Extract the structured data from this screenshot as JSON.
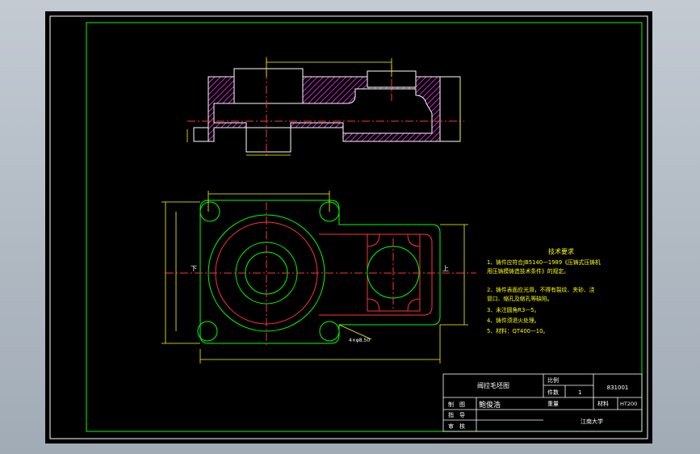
{
  "tech_requirements": {
    "title": "技术要求",
    "lines": [
      "1、铸件应符合JB5140—1989《压铸式压铸机",
      "用压铸模铸造技术条件》的规定。",
      "2、铸件表面应光滑，不得有裂纹、夹砂、浇",
      "冒口、缩孔及缩孔等缺陷。",
      "3、未注圆角R3—5。",
      "4、铸件须退火处理。",
      "5、材料：QT400—10。"
    ]
  },
  "labels": {
    "left_arrow": "下",
    "right_arrow": "上",
    "hole_note": "4×φ8.50"
  },
  "title_block": {
    "drawing_name": "阀拉毛坯图",
    "scale_label": "比例",
    "qty_label": "件数",
    "qty_value": "1",
    "drawing_no": "831001",
    "drawn_label": "制　图",
    "drawn_by": "鲍俊浩",
    "guide_label": "指　导",
    "check_label": "审　核",
    "weight_label": "重量",
    "material_label": "材料",
    "material_value": "HT200",
    "school": "江南大学"
  },
  "colors": {
    "frame": "#00ff00",
    "outline_green": "#00ff00",
    "outline_red": "#ff3333",
    "dimension": "#ffff00",
    "hatch": "#ff33ff",
    "text_white": "#ffffff"
  }
}
